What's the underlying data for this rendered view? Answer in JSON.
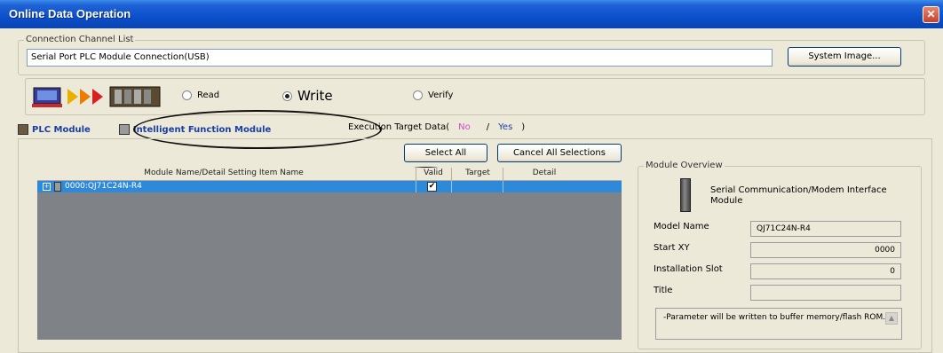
{
  "window": {
    "title": "Online Data Operation",
    "close_glyph": "✕"
  },
  "connection": {
    "legend": "Connection Channel List",
    "value": "Serial Port  PLC Module Connection(USB)",
    "system_image_button": "System Image..."
  },
  "operation": {
    "options": [
      {
        "label": "Read",
        "selected": false
      },
      {
        "label": "Write",
        "selected": true
      },
      {
        "label": "Verify",
        "selected": false
      }
    ]
  },
  "tabs": [
    {
      "label": "PLC Module",
      "icon": "plc-module-icon"
    },
    {
      "label": "Intelligent Function Module",
      "icon": "intelligent-module-icon"
    }
  ],
  "execution_target": {
    "label": "Execution Target Data(",
    "no": "No",
    "slash": "/",
    "yes": "Yes",
    "close": ")"
  },
  "toolbar": {
    "select_all": "Select All",
    "cancel_all": "Cancel All Selections"
  },
  "grid": {
    "columns": [
      "Module Name/Detail Setting Item Name",
      "Valid",
      "Target",
      "Detail"
    ],
    "rows": [
      {
        "expander": "+",
        "name": "0000:QJ71C24N-R4",
        "valid_checked": true,
        "check_glyph": "✔"
      }
    ]
  },
  "overview": {
    "legend": "Module Overview",
    "module_type": "Serial Communication/Modem Interface Module",
    "fields": [
      {
        "label": "Model Name",
        "value": "QJ71C24N-R4"
      },
      {
        "label": "Start XY",
        "value": "0000"
      },
      {
        "label": "Installation Slot",
        "value": "0"
      },
      {
        "label": "Title",
        "value": ""
      }
    ],
    "note": "-Parameter will be written to buffer memory/flash ROM.",
    "scroll_glyph": "▲"
  },
  "colors": {
    "title_bar": "#0a4fcb",
    "selection": "#2e89d9",
    "no_text": "#d04ad0",
    "yes_text": "#1a3ea8"
  }
}
